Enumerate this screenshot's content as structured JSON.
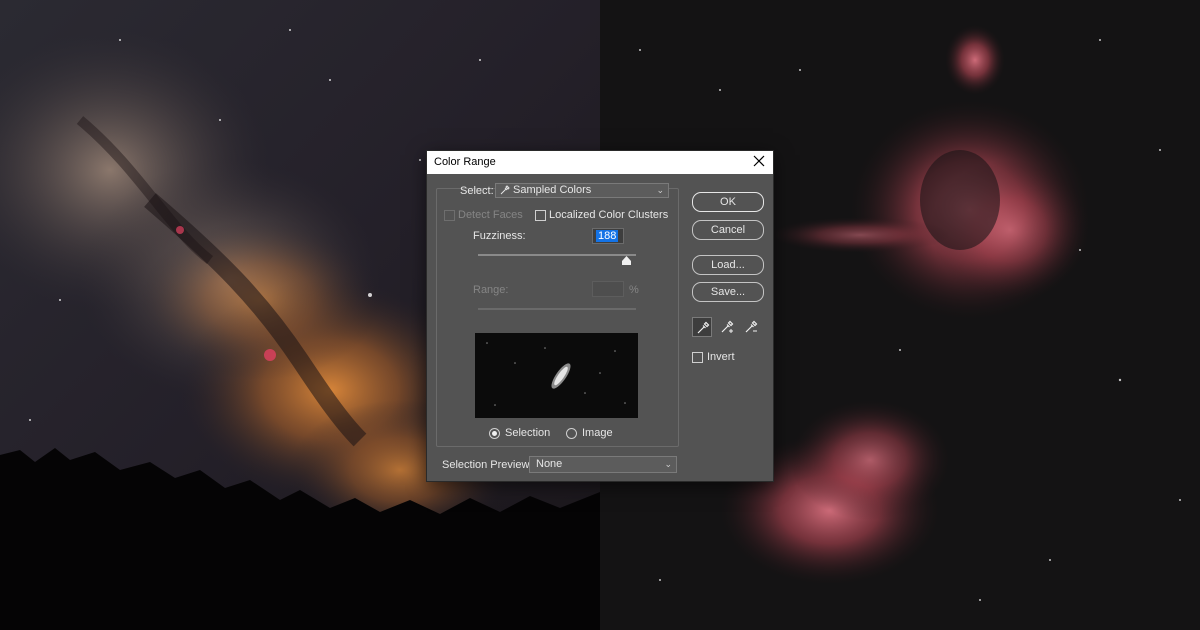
{
  "dialog": {
    "title": "Color Range",
    "select_label": "Select:",
    "select_value": "Sampled Colors",
    "detect_faces_label": "Detect Faces",
    "localized_clusters_label": "Localized Color Clusters",
    "fuzziness_label": "Fuzziness:",
    "fuzziness_value": "188",
    "fuzziness_fraction": 0.94,
    "range_label": "Range:",
    "range_unit": "%",
    "view_selection_label": "Selection",
    "view_image_label": "Image",
    "view_selected": "Selection",
    "selection_preview_label": "Selection Preview:",
    "selection_preview_value": "None",
    "buttons": {
      "ok": "OK",
      "cancel": "Cancel",
      "load": "Load...",
      "save": "Save..."
    },
    "tools": [
      "eyedropper-icon",
      "eyedropper-plus-icon",
      "eyedropper-minus-icon"
    ],
    "invert_label": "Invert"
  },
  "colors": {
    "dialog_bg": "#535353",
    "accent": "#1473e6",
    "nebula": "#c0505e",
    "milky_way": "#c07830"
  }
}
